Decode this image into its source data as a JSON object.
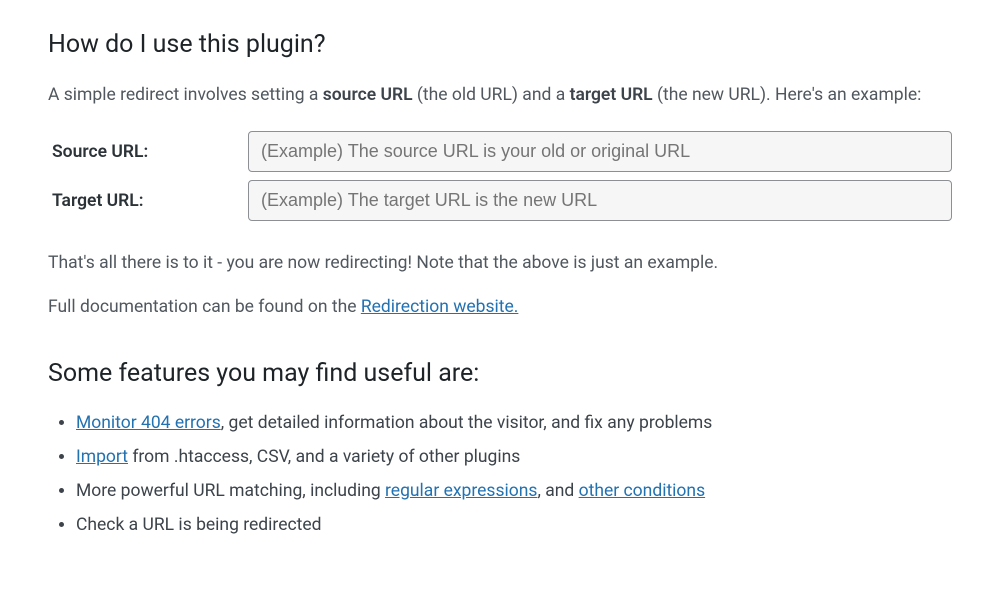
{
  "heading1": "How do I use this plugin?",
  "intro": {
    "pre": "A simple redirect involves setting a ",
    "bold1": "source URL",
    "mid": " (the old URL) and a ",
    "bold2": "target URL",
    "post": " (the new URL). Here's an example:"
  },
  "form": {
    "source_label": "Source URL:",
    "source_placeholder": "(Example) The source URL is your old or original URL",
    "target_label": "Target URL:",
    "target_placeholder": "(Example) The target URL is the new URL"
  },
  "after1": "That's all there is to it - you are now redirecting! Note that the above is just an example.",
  "after2_pre": "Full documentation can be found on the ",
  "after2_link": "Redirection website.",
  "heading2": "Some features you may find useful are:",
  "features": {
    "f1_link": "Monitor 404 errors",
    "f1_rest": ", get detailed information about the visitor, and fix any problems",
    "f2_link": "Import",
    "f2_rest": " from .htaccess, CSV, and a variety of other plugins",
    "f3_pre": "More powerful URL matching, including ",
    "f3_link1": "regular expressions",
    "f3_mid": ", and ",
    "f3_link2": "other conditions",
    "f4": "Check a URL is being redirected"
  }
}
